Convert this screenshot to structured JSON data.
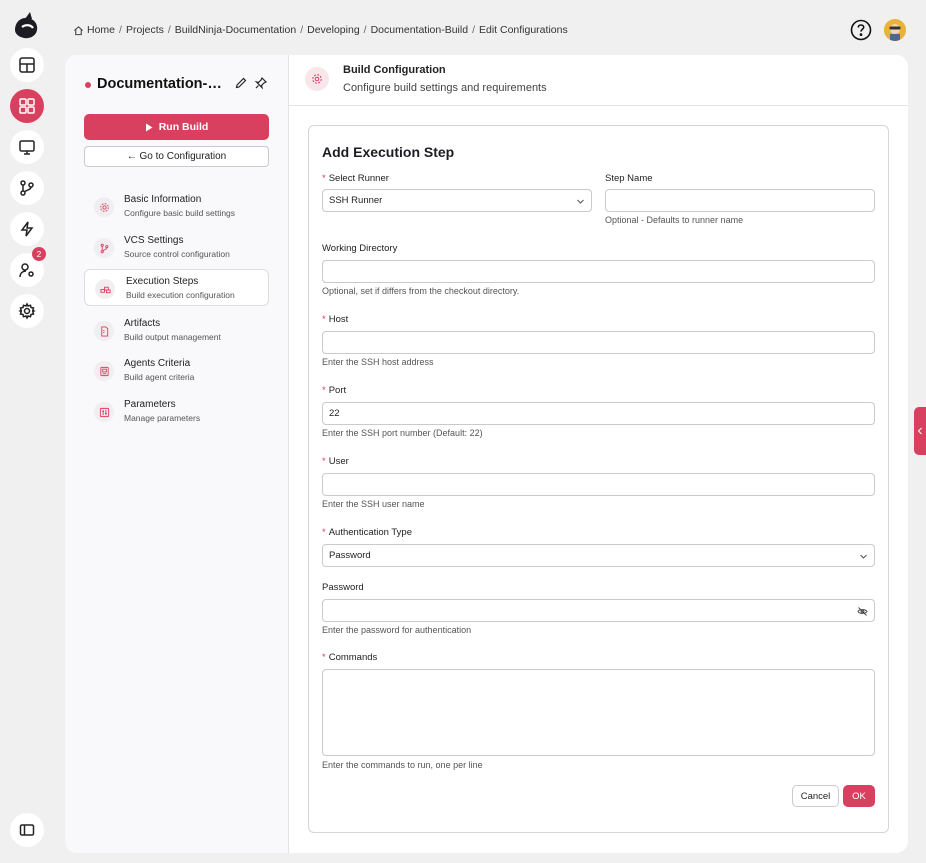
{
  "breadcrumb": [
    "Home",
    "Projects",
    "BuildNinja-Documentation",
    "Developing",
    "Documentation-Build",
    "Edit Configurations"
  ],
  "rail": {
    "notification_count": "2"
  },
  "sidebar": {
    "project_title": "Documentation-Build",
    "run_label": "Run Build",
    "goto_label": "← Go to Configuration",
    "items": [
      {
        "title": "Basic Information",
        "sub": "Configure basic build settings",
        "icon": "settings-icon"
      },
      {
        "title": "VCS Settings",
        "sub": "Source control configuration",
        "icon": "git-branch-icon"
      },
      {
        "title": "Execution Steps",
        "sub": "Build execution configuration",
        "icon": "steps-icon"
      },
      {
        "title": "Artifacts",
        "sub": "Build output management",
        "icon": "file-icon"
      },
      {
        "title": "Agents Criteria",
        "sub": "Build agent criteria",
        "icon": "agent-icon"
      },
      {
        "title": "Parameters",
        "sub": "Manage parameters",
        "icon": "sliders-icon"
      }
    ]
  },
  "header": {
    "title": "Build Configuration",
    "subtitle": "Configure build settings and requirements"
  },
  "form": {
    "title": "Add Execution Step",
    "runner_label": "Select Runner",
    "runner_value": "SSH Runner",
    "step_name_label": "Step Name",
    "step_name_value": "",
    "step_name_hint": "Optional - Defaults to runner name",
    "workdir_label": "Working Directory",
    "workdir_value": "",
    "workdir_hint": "Optional, set if differs from the checkout directory.",
    "host_label": "Host",
    "host_value": "",
    "host_hint": "Enter the SSH host address",
    "port_label": "Port",
    "port_value": "22",
    "port_hint": "Enter the SSH port number (Default: 22)",
    "user_label": "User",
    "user_value": "",
    "user_hint": "Enter the SSH user name",
    "auth_label": "Authentication Type",
    "auth_value": "Password",
    "password_label": "Password",
    "password_value": "",
    "password_hint": "Enter the password for authentication",
    "commands_label": "Commands",
    "commands_value": "",
    "commands_hint": "Enter the commands to run, one per line",
    "cancel_label": "Cancel",
    "ok_label": "OK"
  },
  "colors": {
    "accent": "#d9405f"
  }
}
